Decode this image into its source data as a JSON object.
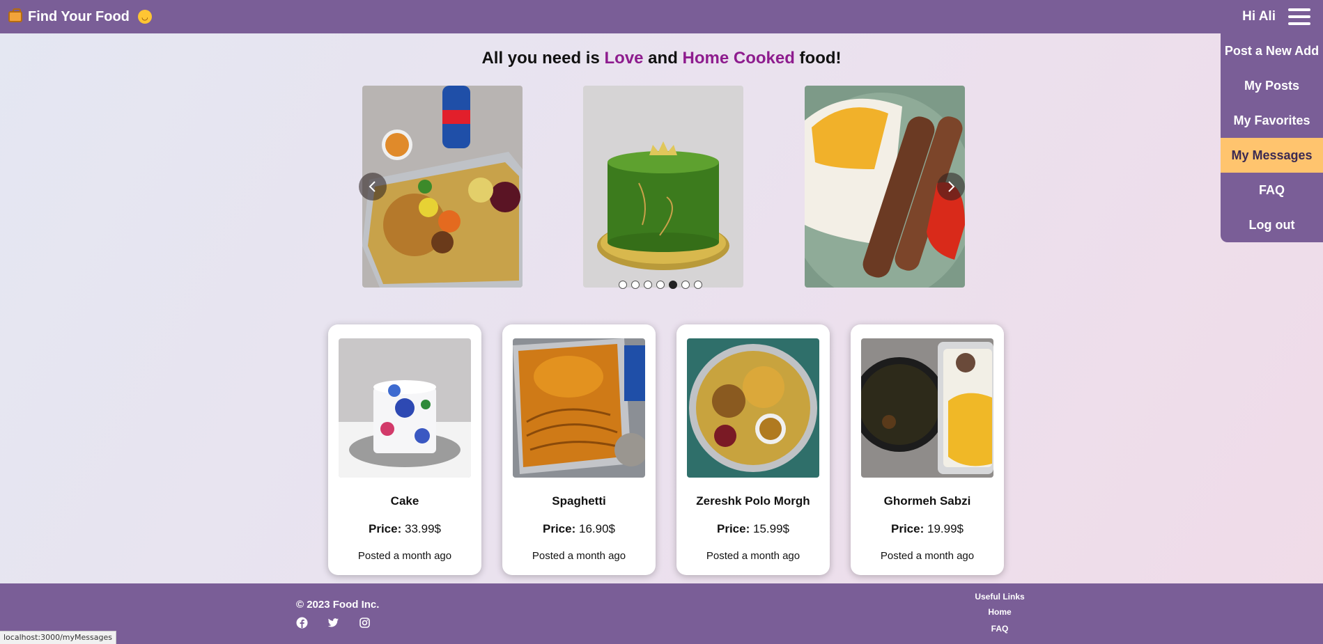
{
  "nav": {
    "brand": "Find Your Food",
    "greeting": "Hi Ali"
  },
  "menu": {
    "items": [
      {
        "label": "Post a New Add"
      },
      {
        "label": "My Posts"
      },
      {
        "label": "My Favorites"
      },
      {
        "label": "My Messages",
        "active": true
      },
      {
        "label": "FAQ"
      },
      {
        "label": "Log out"
      }
    ]
  },
  "headline": {
    "part1": "All you need is ",
    "love": "Love",
    "part2": " and ",
    "home_cooked": "Home Cooked",
    "part3": " food!"
  },
  "carousel": {
    "slide_count": 7,
    "active_index": 4
  },
  "cards": [
    {
      "title": "Cake",
      "price_label": "Price:",
      "price": "33.99$",
      "posted": "Posted a month ago"
    },
    {
      "title": "Spaghetti",
      "price_label": "Price:",
      "price": "16.90$",
      "posted": "Posted a month ago"
    },
    {
      "title": "Zereshk Polo Morgh",
      "price_label": "Price:",
      "price": "15.99$",
      "posted": "Posted a month ago"
    },
    {
      "title": "Ghormeh Sabzi",
      "price_label": "Price:",
      "price": "19.99$",
      "posted": "Posted a month ago"
    }
  ],
  "footer": {
    "copyright": "© 2023 Food Inc.",
    "useful_links_title": "Useful Links",
    "links": [
      "Home",
      "FAQ"
    ],
    "socials": [
      "facebook-icon",
      "twitter-icon",
      "instagram-icon"
    ]
  },
  "status_bar": {
    "url": "localhost:3000/myMessages"
  },
  "colors": {
    "nav_bg": "#7a5e97",
    "menu_active": "#ffc46e",
    "headline_accent": "#8e1c8e"
  }
}
